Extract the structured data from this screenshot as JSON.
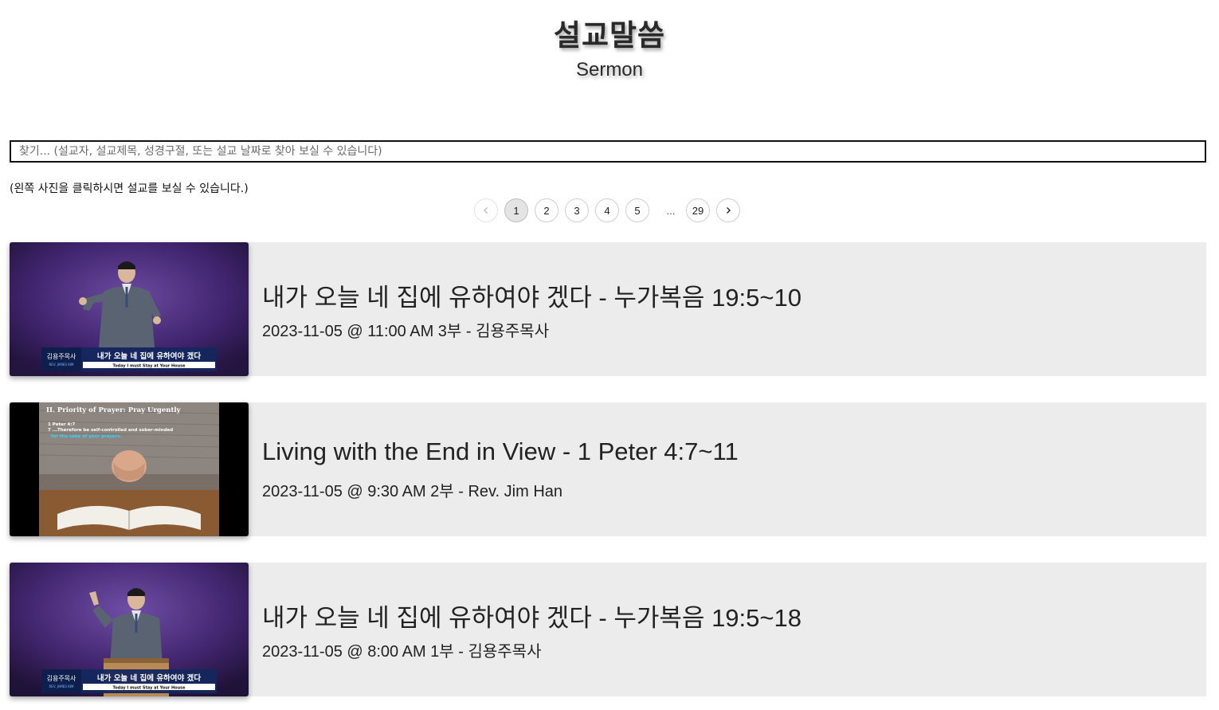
{
  "header": {
    "title": "설교말씀",
    "subtitle": "Sermon"
  },
  "search": {
    "placeholder": "찾기... (설교자, 설교제목, 성경구절, 또는 설교 날짜로 찾아 보실 수 있습니다)",
    "value": ""
  },
  "hint": "(왼쪽 사진을 클릭하시면 설교를 보실 수 있습니다.)",
  "pagination": {
    "pages": [
      "1",
      "2",
      "3",
      "4",
      "5"
    ],
    "ellipsis": "...",
    "last": "29",
    "current": "1",
    "prev_icon": "chevron-left-icon",
    "next_icon": "chevron-right-icon"
  },
  "sermons": [
    {
      "title": "내가 오늘 네 집에 유하여야 겠다 - 누가복음 19:5~10",
      "meta": "2023-11-05 @ 11:00 AM 3부 - 김용주목사",
      "thumb": {
        "preacher_ko": "김용주목사",
        "preacher_en": "REV. JAMES KIM",
        "caption_ko": "내가 오늘 네 집에 유하여야 겠다",
        "caption_en": "Today I must Stay at Your House"
      }
    },
    {
      "title": "Living with the End in View - 1 Peter 4:7~11",
      "meta": "2023-11-05 @ 9:30 AM 2부 - Rev. Jim Han",
      "thumb": {
        "heading": "II. Priority of Prayer:  Pray Urgently",
        "ref": "1 Peter 4:7",
        "line1": "7 ...Therefore be self-controlled and sober-minded",
        "line2": "for the sake of your prayers."
      }
    },
    {
      "title": "내가 오늘 네 집에 유하여야 겠다 - 누가복음 19:5~18",
      "meta": "2023-11-05 @ 8:00 AM 1부 - 김용주목사",
      "thumb": {
        "preacher_ko": "김용주목사",
        "preacher_en": "REV. JAMES KIM",
        "caption_ko": "내가 오늘 네 집에 유하여야 겠다",
        "caption_en": "Today I must Stay at Your House"
      }
    }
  ],
  "colors": {
    "row_bg": "#ececec",
    "stage_purple": "#4a2a78",
    "lower_third_navy": "#14275e",
    "accent_cyan": "#33d3ff"
  }
}
